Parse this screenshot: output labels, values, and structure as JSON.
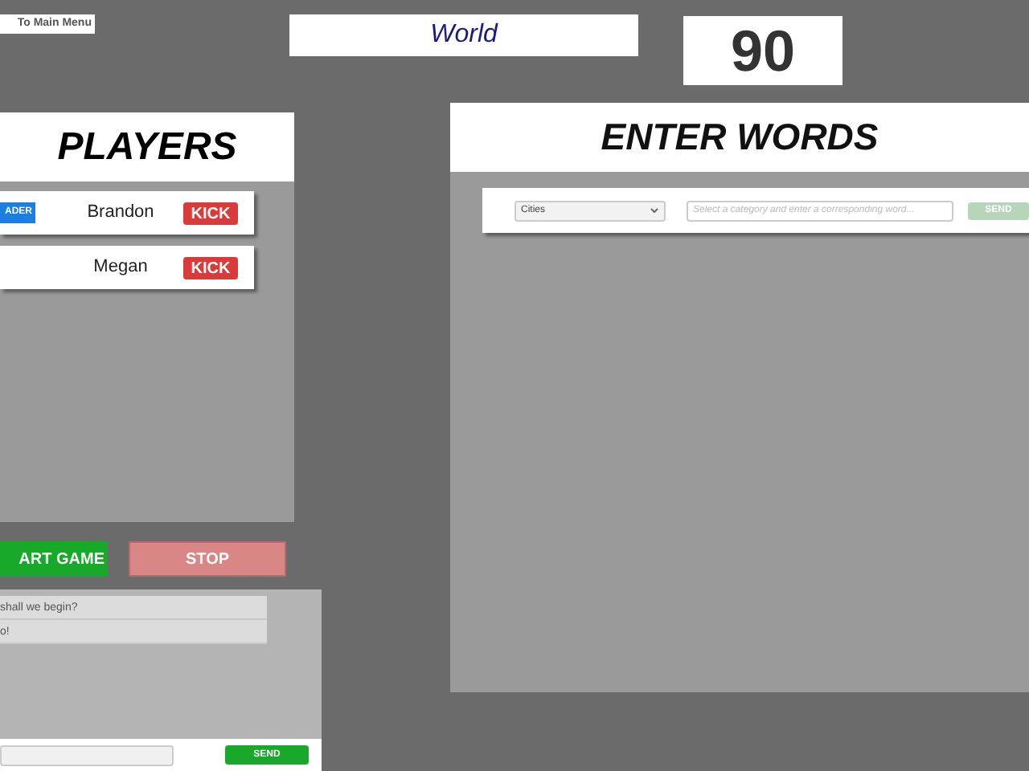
{
  "menu_button": {
    "label": "To Main Menu"
  },
  "category_title": "World",
  "timer": "90",
  "players": {
    "title": "PLAYERS",
    "rows": [
      {
        "leader_badge": "ADER",
        "name": "Brandon",
        "kick": "KICK"
      },
      {
        "name": "Megan",
        "kick": "KICK"
      }
    ]
  },
  "controls": {
    "start": {
      "label": "ART GAME",
      "disabled": false
    },
    "stop": {
      "label": "STOP",
      "disabled": true
    }
  },
  "chat": {
    "messages": [
      "shall we begin?",
      "o!"
    ],
    "send": "SEND"
  },
  "words": {
    "title": "ENTER WORDS",
    "category": "Cities",
    "placeholder": "Select a category and enter a corresponding word...",
    "send": {
      "label": "SEND",
      "disabled": true
    }
  }
}
